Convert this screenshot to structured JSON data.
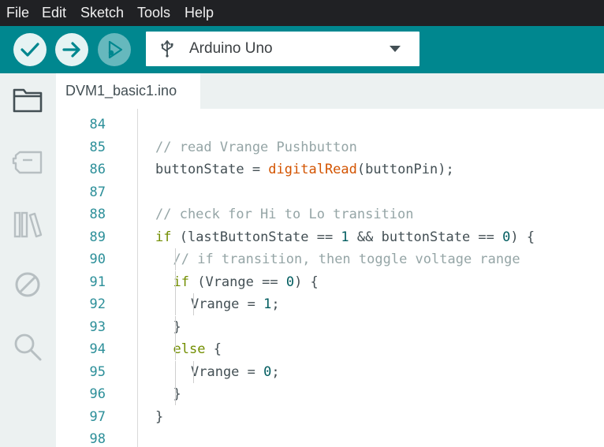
{
  "menu": [
    "File",
    "Edit",
    "Sketch",
    "Tools",
    "Help"
  ],
  "toolbar": {
    "verify_icon": "check-icon",
    "upload_icon": "arrow-right-icon",
    "debug_icon": "debug-play-icon",
    "board": "Arduino Uno",
    "board_icon": "usb-icon"
  },
  "sidebar": [
    "folder-icon",
    "boards-manager-icon",
    "library-icon",
    "debug-disabled-icon",
    "search-icon"
  ],
  "tab": {
    "label": "DVM1_basic1.ino"
  },
  "colors": {
    "toolbar": "#00878f",
    "menubar": "#202124",
    "sidebar": "#ecf1f1",
    "line_number": "#2c8f99",
    "comment": "#95a5a6",
    "keyword": "#728e00",
    "function": "#d35400",
    "number": "#005c5f",
    "text": "#434f54"
  },
  "code_lines": [
    {
      "n": "84",
      "indent": 0,
      "tokens": []
    },
    {
      "n": "85",
      "indent": 0,
      "tokens": [
        {
          "t": "// read Vrange Pushbutton",
          "c": "comment"
        }
      ]
    },
    {
      "n": "86",
      "indent": 0,
      "tokens": [
        {
          "t": "buttonState = ",
          "c": "text"
        },
        {
          "t": "digitalRead",
          "c": "function"
        },
        {
          "t": "(buttonPin);",
          "c": "text"
        }
      ]
    },
    {
      "n": "87",
      "indent": 0,
      "tokens": []
    },
    {
      "n": "88",
      "indent": 0,
      "tokens": [
        {
          "t": "// check for Hi to Lo transition",
          "c": "comment"
        }
      ]
    },
    {
      "n": "89",
      "indent": 0,
      "tokens": [
        {
          "t": "if",
          "c": "keyword"
        },
        {
          "t": " (lastButtonState == ",
          "c": "text"
        },
        {
          "t": "1",
          "c": "number"
        },
        {
          "t": " && buttonState == ",
          "c": "text"
        },
        {
          "t": "0",
          "c": "number"
        },
        {
          "t": ") {",
          "c": "text"
        }
      ]
    },
    {
      "n": "90",
      "indent": 1,
      "tokens": [
        {
          "t": "// if transition, then toggle voltage range",
          "c": "comment"
        }
      ]
    },
    {
      "n": "91",
      "indent": 1,
      "tokens": [
        {
          "t": "if",
          "c": "keyword"
        },
        {
          "t": " (Vrange == ",
          "c": "text"
        },
        {
          "t": "0",
          "c": "number"
        },
        {
          "t": ") {",
          "c": "text"
        }
      ]
    },
    {
      "n": "92",
      "indent": 2,
      "tokens": [
        {
          "t": "Vrange = ",
          "c": "text"
        },
        {
          "t": "1",
          "c": "number"
        },
        {
          "t": ";",
          "c": "text"
        }
      ]
    },
    {
      "n": "93",
      "indent": 1,
      "tokens": [
        {
          "t": "}",
          "c": "text"
        }
      ]
    },
    {
      "n": "94",
      "indent": 1,
      "tokens": [
        {
          "t": "else",
          "c": "keyword"
        },
        {
          "t": " {",
          "c": "text"
        }
      ]
    },
    {
      "n": "95",
      "indent": 2,
      "tokens": [
        {
          "t": "Vrange = ",
          "c": "text"
        },
        {
          "t": "0",
          "c": "number"
        },
        {
          "t": ";",
          "c": "text"
        }
      ]
    },
    {
      "n": "96",
      "indent": 1,
      "tokens": [
        {
          "t": "}",
          "c": "text"
        }
      ]
    },
    {
      "n": "97",
      "indent": 0,
      "tokens": [
        {
          "t": "}",
          "c": "text"
        }
      ]
    },
    {
      "n": "98",
      "indent": 0,
      "tokens": []
    }
  ]
}
